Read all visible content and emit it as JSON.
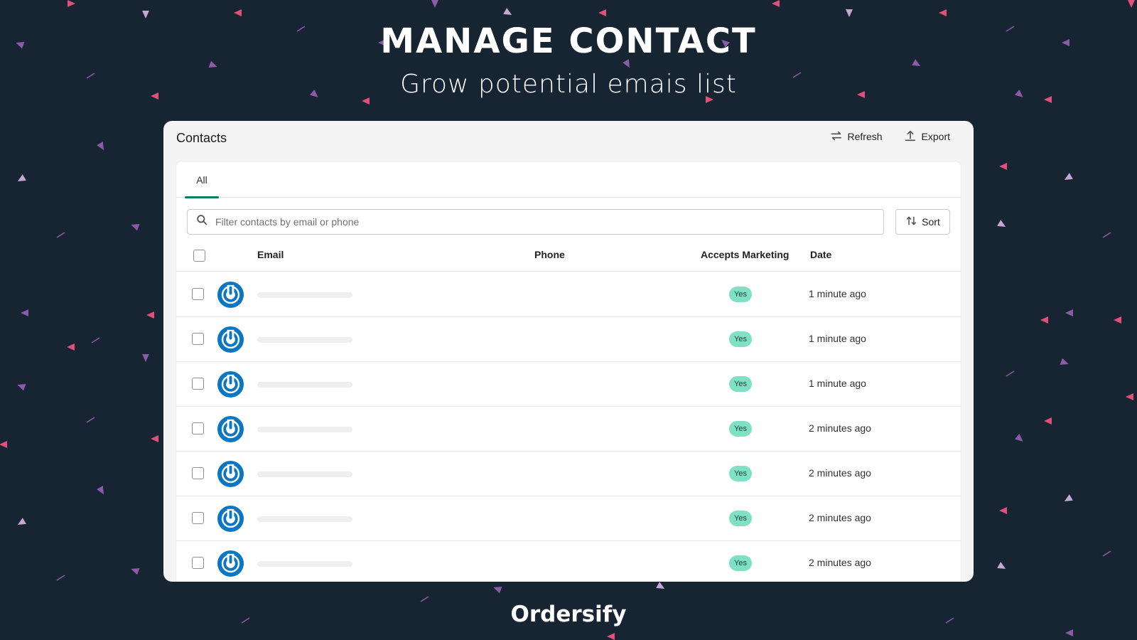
{
  "hero": {
    "title": "MANAGE CONTACT",
    "subtitle": "Grow potential emais list",
    "brand": "Ordersify"
  },
  "colors": {
    "background": "#172532",
    "accent_tab": "#008060",
    "badge_bg": "#7fe0c4",
    "avatar_blue": "#0b77c2",
    "confetti_pink": "#e0507a",
    "confetti_purple": "#8a5ca8",
    "confetti_lilac": "#c4a8d2"
  },
  "window": {
    "title": "Contacts",
    "actions": [
      {
        "label": "Refresh",
        "icon": "refresh-icon"
      },
      {
        "label": "Export",
        "icon": "export-icon"
      }
    ]
  },
  "tabs": [
    {
      "label": "All",
      "active": true
    }
  ],
  "filter": {
    "search_placeholder": "Filter contacts by email or phone",
    "search_value": "",
    "sort_label": "Sort"
  },
  "table": {
    "columns": [
      "Email",
      "Phone",
      "Accepts Marketing",
      "Date"
    ],
    "rows": [
      {
        "email": "",
        "phone": "",
        "accepts_marketing": "Yes",
        "date": "1 minute ago"
      },
      {
        "email": "",
        "phone": "",
        "accepts_marketing": "Yes",
        "date": "1 minute ago"
      },
      {
        "email": "",
        "phone": "",
        "accepts_marketing": "Yes",
        "date": "1 minute ago"
      },
      {
        "email": "",
        "phone": "",
        "accepts_marketing": "Yes",
        "date": "2 minutes ago"
      },
      {
        "email": "",
        "phone": "",
        "accepts_marketing": "Yes",
        "date": "2 minutes ago"
      },
      {
        "email": "",
        "phone": "",
        "accepts_marketing": "Yes",
        "date": "2 minutes ago"
      },
      {
        "email": "",
        "phone": "",
        "accepts_marketing": "Yes",
        "date": "2 minutes ago"
      }
    ]
  }
}
